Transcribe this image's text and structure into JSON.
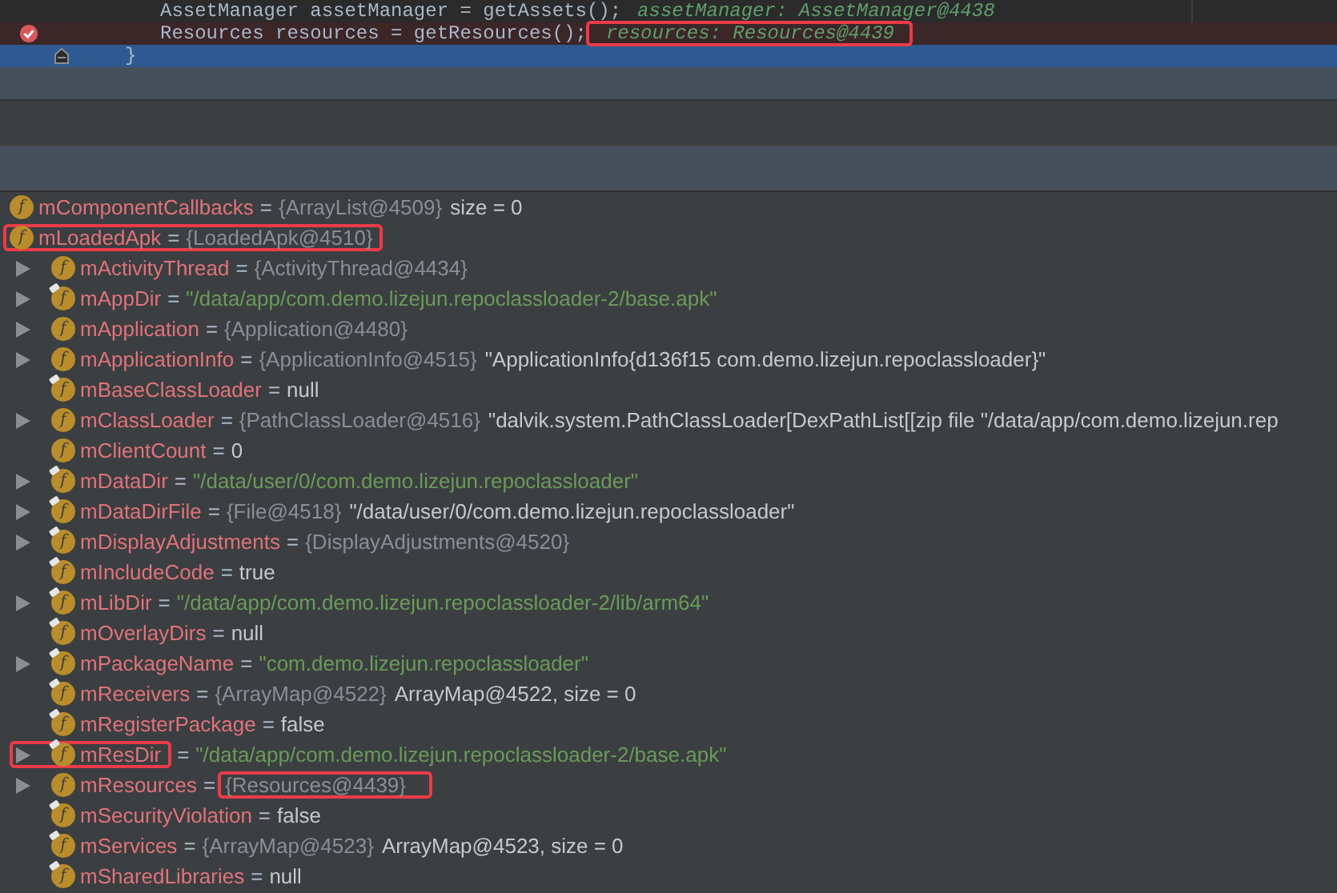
{
  "editor": {
    "lines": [
      {
        "code": "AssetManager assetManager = getAssets();",
        "inline_value": "assetManager: AssetManager@4438",
        "breakpoint": false,
        "selected": false,
        "fold": false
      },
      {
        "code": "Resources resources = getResources();",
        "inline_value": "resources: Resources@4439",
        "highlighted": true,
        "breakpoint": true,
        "selected": false,
        "fold": false
      },
      {
        "code": "}",
        "breakpoint": false,
        "selected": true,
        "fold": true
      }
    ]
  },
  "variables": [
    {
      "icon": "f",
      "name": "mComponentCallbacks",
      "op": "=",
      "value": "{ArrayList@4509}",
      "kind": "ref",
      "detail": "size = 0",
      "final": false
    },
    {
      "icon": "f",
      "name": "mLoadedApk",
      "op": "=",
      "value": "{LoadedApk@4510}",
      "kind": "ref",
      "final": false,
      "highlighted": true,
      "children": [
        {
          "icon": "f",
          "name": "mActivityThread",
          "op": "=",
          "value": "{ActivityThread@4434}",
          "kind": "ref",
          "final": false,
          "expandable": true
        },
        {
          "icon": "f",
          "name": "mAppDir",
          "op": "=",
          "value": "\"/data/app/com.demo.lizejun.repoclassloader-2/base.apk\"",
          "kind": "string",
          "final": true,
          "expandable": true
        },
        {
          "icon": "f",
          "name": "mApplication",
          "op": "=",
          "value": "{Application@4480}",
          "kind": "ref",
          "final": false,
          "expandable": true
        },
        {
          "icon": "f",
          "name": "mApplicationInfo",
          "op": "=",
          "value": "{ApplicationInfo@4515}",
          "kind": "ref",
          "detail": "\"ApplicationInfo{d136f15 com.demo.lizejun.repoclassloader}\"",
          "final": false,
          "expandable": true
        },
        {
          "icon": "f",
          "name": "mBaseClassLoader",
          "op": "=",
          "value": "null",
          "kind": "plain",
          "final": true,
          "expandable": false
        },
        {
          "icon": "f",
          "name": "mClassLoader",
          "op": "=",
          "value": "{PathClassLoader@4516}",
          "kind": "ref",
          "detail": "\"dalvik.system.PathClassLoader[DexPathList[[zip file \"/data/app/com.demo.lizejun.rep",
          "final": false,
          "expandable": true
        },
        {
          "icon": "f",
          "name": "mClientCount",
          "op": "=",
          "value": "0",
          "kind": "plain",
          "final": false,
          "expandable": false
        },
        {
          "icon": "f",
          "name": "mDataDir",
          "op": "=",
          "value": "\"/data/user/0/com.demo.lizejun.repoclassloader\"",
          "kind": "string",
          "final": true,
          "expandable": true
        },
        {
          "icon": "f",
          "name": "mDataDirFile",
          "op": "=",
          "value": "{File@4518}",
          "kind": "ref",
          "detail": "\"/data/user/0/com.demo.lizejun.repoclassloader\"",
          "final": true,
          "expandable": true
        },
        {
          "icon": "f",
          "name": "mDisplayAdjustments",
          "op": "=",
          "value": "{DisplayAdjustments@4520}",
          "kind": "ref",
          "final": true,
          "expandable": true
        },
        {
          "icon": "f",
          "name": "mIncludeCode",
          "op": "=",
          "value": "true",
          "kind": "plain",
          "final": true,
          "expandable": false
        },
        {
          "icon": "f",
          "name": "mLibDir",
          "op": "=",
          "value": "\"/data/app/com.demo.lizejun.repoclassloader-2/lib/arm64\"",
          "kind": "string",
          "final": true,
          "expandable": true
        },
        {
          "icon": "f",
          "name": "mOverlayDirs",
          "op": "=",
          "value": "null",
          "kind": "plain",
          "final": true,
          "expandable": false
        },
        {
          "icon": "f",
          "name": "mPackageName",
          "op": "=",
          "value": "\"com.demo.lizejun.repoclassloader\"",
          "kind": "string",
          "final": true,
          "expandable": true
        },
        {
          "icon": "f",
          "name": "mReceivers",
          "op": "=",
          "value": "{ArrayMap@4522}",
          "kind": "ref",
          "detail": "ArrayMap@4522, size = 0",
          "final": true,
          "expandable": false
        },
        {
          "icon": "f",
          "name": "mRegisterPackage",
          "op": "=",
          "value": "false",
          "kind": "plain",
          "final": true,
          "expandable": false
        },
        {
          "icon": "f",
          "name": "mResDir",
          "op": "=",
          "value": "\"/data/app/com.demo.lizejun.repoclassloader-2/base.apk\"",
          "kind": "string",
          "final": true,
          "expandable": true,
          "name_highlighted": true
        },
        {
          "icon": "f",
          "name": "mResources",
          "op": "=",
          "value": "{Resources@4439}",
          "kind": "ref",
          "final": false,
          "expandable": true,
          "value_highlighted": true
        },
        {
          "icon": "f",
          "name": "mSecurityViolation",
          "op": "=",
          "value": "false",
          "kind": "plain",
          "final": true,
          "expandable": false
        },
        {
          "icon": "f",
          "name": "mServices",
          "op": "=",
          "value": "{ArrayMap@4523}",
          "kind": "ref",
          "detail": "ArrayMap@4523, size = 0",
          "final": true,
          "expandable": false
        },
        {
          "icon": "f",
          "name": "mSharedLibraries",
          "op": "=",
          "value": "null",
          "kind": "plain",
          "final": true,
          "expandable": false
        }
      ]
    }
  ]
}
